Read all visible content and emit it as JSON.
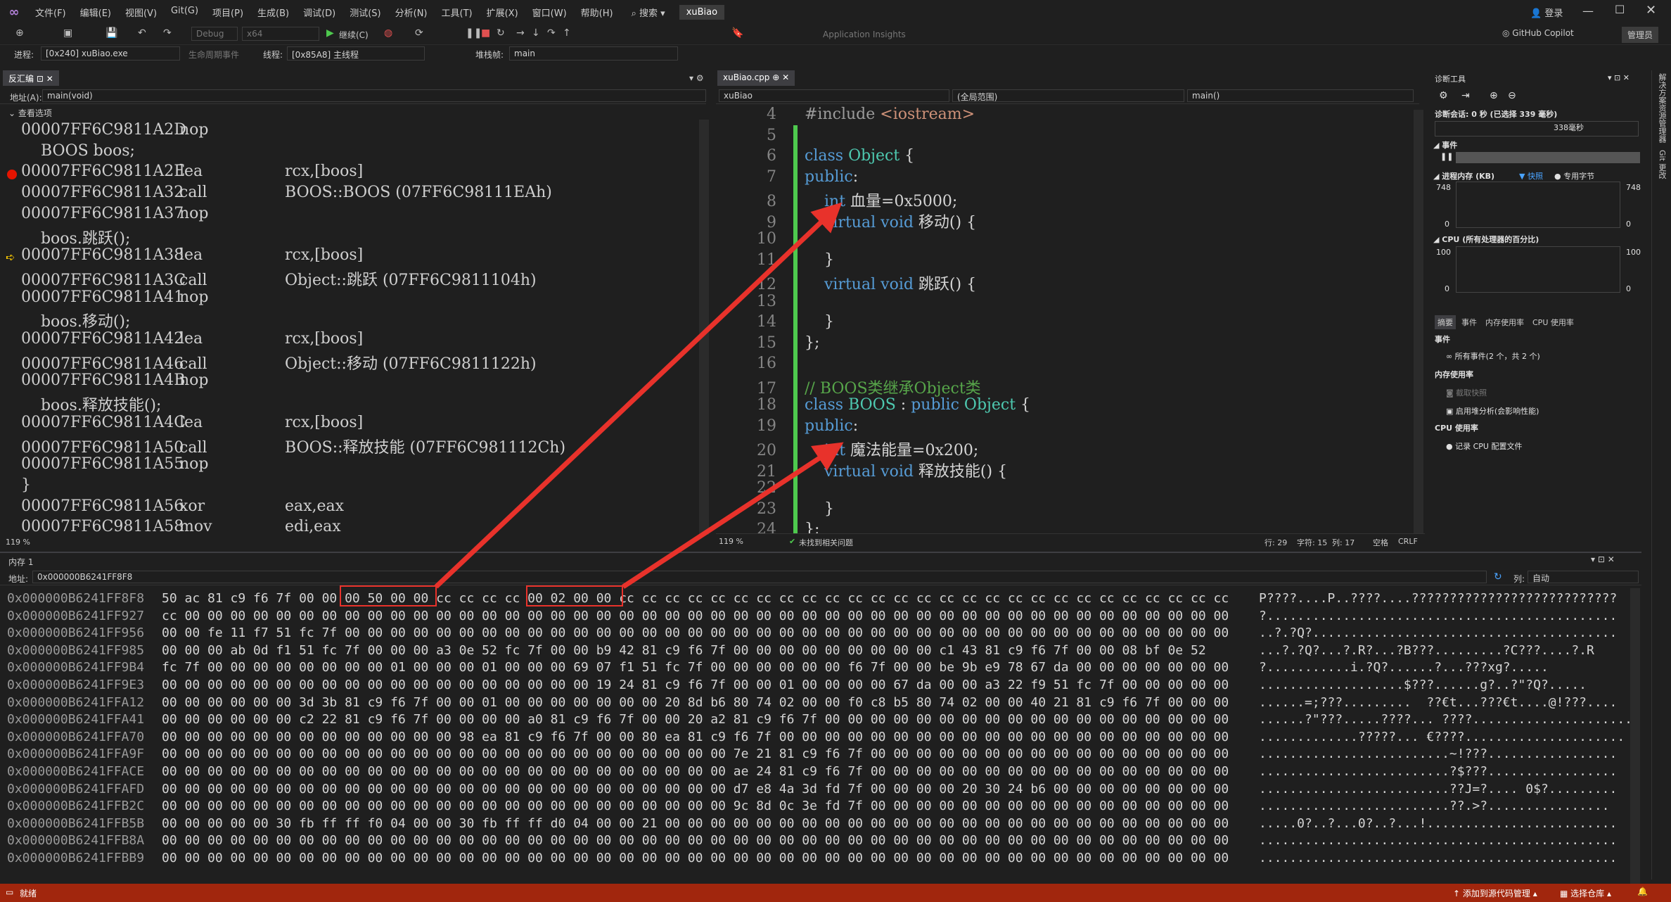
{
  "menu": {
    "logo": "vs-logo-icon",
    "items": [
      "文件(F)",
      "编辑(E)",
      "视图(V)",
      "Git(G)",
      "项目(P)",
      "生成(B)",
      "调试(D)",
      "测试(S)",
      "分析(N)",
      "工具(T)",
      "扩展(X)",
      "窗口(W)",
      "帮助(H)"
    ],
    "search": "搜索",
    "solution": "xuBiao",
    "login": "登录",
    "copilot": "GitHub Copilot",
    "admin": "管理员"
  },
  "toolbar": {
    "config": "Debug",
    "platform": "x64",
    "continue": "继续(C)",
    "app_insights": "Application Insights",
    "process_label": "进程:",
    "process_value": "[0x240] xuBiao.exe",
    "lifecycle": "生命周期事件",
    "thread_label": "线程:",
    "thread_value": "[0x85A8] 主线程",
    "stack_label": "堆栈帧:",
    "stack_value": "main"
  },
  "disasm": {
    "tab": "反汇编",
    "address_label": "地址(A):",
    "address_value": "main(void)",
    "options": "查看选项",
    "zoom": "119 %",
    "lines": [
      {
        "addr": "00007FF6C9811A2D",
        "mn": "nop",
        "op": ""
      },
      {
        "src": "    BOOS boos;"
      },
      {
        "addr": "00007FF6C9811A2E",
        "mn": "lea",
        "op": "rcx,[boos]",
        "bp": true
      },
      {
        "addr": "00007FF6C9811A32",
        "mn": "call",
        "op": "BOOS::BOOS (07FF6C98111EAh)"
      },
      {
        "addr": "00007FF6C9811A37",
        "mn": "nop",
        "op": ""
      },
      {
        "src": "    boos.跳跃();"
      },
      {
        "addr": "00007FF6C9811A38",
        "mn": "lea",
        "op": "rcx,[boos]",
        "cur": true
      },
      {
        "addr": "00007FF6C9811A3C",
        "mn": "call",
        "op": "Object::跳跃 (07FF6C9811104h)"
      },
      {
        "addr": "00007FF6C9811A41",
        "mn": "nop",
        "op": ""
      },
      {
        "src": "    boos.移动();"
      },
      {
        "addr": "00007FF6C9811A42",
        "mn": "lea",
        "op": "rcx,[boos]"
      },
      {
        "addr": "00007FF6C9811A46",
        "mn": "call",
        "op": "Object::移动 (07FF6C9811122h)"
      },
      {
        "addr": "00007FF6C9811A4B",
        "mn": "nop",
        "op": ""
      },
      {
        "src": "    boos.释放技能();"
      },
      {
        "addr": "00007FF6C9811A4C",
        "mn": "lea",
        "op": "rcx,[boos]"
      },
      {
        "addr": "00007FF6C9811A50",
        "mn": "call",
        "op": "BOOS::释放技能 (07FF6C981112Ch)"
      },
      {
        "addr": "00007FF6C9811A55",
        "mn": "nop",
        "op": ""
      },
      {
        "src": "}"
      },
      {
        "addr": "00007FF6C9811A56",
        "mn": "xor",
        "op": "eax,eax"
      },
      {
        "addr": "00007FF6C9811A58",
        "mn": "mov",
        "op": "edi,eax"
      }
    ]
  },
  "editor": {
    "tab": "xuBiao.cpp",
    "project": "xuBiao",
    "scope": "(全局范围)",
    "func": "main()",
    "zoom": "119 %",
    "issues": "未找到相关问题",
    "row": "行: 29",
    "col": "字符: 15",
    "colnum": "列: 17",
    "spaces": "空格",
    "eol": "CRLF",
    "lines": [
      {
        "n": "4",
        "t": "#include <iostream>"
      },
      {
        "n": "5",
        "t": ""
      },
      {
        "n": "6",
        "t": "class Object {"
      },
      {
        "n": "7",
        "t": "public:"
      },
      {
        "n": "8",
        "t": "    int 血量=0x5000;"
      },
      {
        "n": "9",
        "t": "    virtual void 移动() {"
      },
      {
        "n": "10",
        "t": ""
      },
      {
        "n": "11",
        "t": "    }"
      },
      {
        "n": "12",
        "t": "    virtual void 跳跃() {"
      },
      {
        "n": "13",
        "t": ""
      },
      {
        "n": "14",
        "t": "    }"
      },
      {
        "n": "15",
        "t": "};"
      },
      {
        "n": "16",
        "t": ""
      },
      {
        "n": "17",
        "t": "// BOOS类继承Object类"
      },
      {
        "n": "18",
        "t": "class BOOS : public Object {"
      },
      {
        "n": "19",
        "t": "public:"
      },
      {
        "n": "20",
        "t": "    int 魔法能量=0x200;"
      },
      {
        "n": "21",
        "t": "    virtual void 释放技能() {"
      },
      {
        "n": "22",
        "t": ""
      },
      {
        "n": "23",
        "t": "    }"
      },
      {
        "n": "24",
        "t": "};"
      }
    ]
  },
  "diag": {
    "title": "诊断工具",
    "session": "诊断会话: 0 秒 (已选择 339 毫秒)",
    "ms": "338毫秒",
    "events": "事件",
    "mem_title": "进程内存 (KB)",
    "snapshot": "快照",
    "private_bytes": "专用字节",
    "mem_max": "748",
    "mem_min": "0",
    "cpu_title": "CPU (所有处理器的百分比)",
    "cpu_max": "100",
    "cpu_min": "0",
    "tabs": [
      "摘要",
      "事件",
      "内存使用率",
      "CPU 使用率"
    ],
    "sec_events": "事件",
    "all_events": "所有事件(2 个，共 2 个)",
    "sec_mem": "内存使用率",
    "take_snapshot": "截取快照",
    "heap_analysis": "启用堆分析(会影响性能)",
    "sec_cpu": "CPU 使用率",
    "record_cpu": "记录 CPU 配置文件"
  },
  "memory": {
    "tab": "内存 1",
    "address_label": "地址:",
    "address_value": "0x000000B6241FF8F8",
    "col_label": "列:",
    "col_value": "自动",
    "rows": [
      {
        "a": "0x000000B6241FF8F8",
        "h": "50 ac 81 c9 f6 7f 00 00 00 50 00 00 cc cc cc cc 00 02 00 00 cc cc cc cc cc cc cc cc cc cc cc cc cc cc cc cc cc cc cc cc cc cc cc cc cc cc cc",
        "s": "P????....P..????....???????????????????????????"
      },
      {
        "a": "0x000000B6241FF927",
        "h": "cc 00 00 00 00 00 00 00 00 00 00 00 00 00 00 00 00 00 00 00 00 00 00 00 00 00 00 00 00 00 00 00 00 00 00 00 00 00 00 00 00 00 00 00 00 00 00",
        "s": "?.............................................."
      },
      {
        "a": "0x000000B6241FF956",
        "h": "00 00 fe 11 f7 51 fc 7f 00 00 00 00 00 00 00 00 00 00 00 00 00 00 00 00 00 00 00 00 00 00 00 00 00 00 00 00 00 00 00 00 00 00 00 00 00 00 00",
        "s": "..?.?Q?........................................"
      },
      {
        "a": "0x000000B6241FF985",
        "h": "00 00 00 ab 0d f1 51 fc 7f 00 00 00 a3 0e 52 fc 7f 00 00 b9 42 81 c9 f6 7f 00 00 00 00 00 00 00 00 00 c1 43 81 c9 f6 7f 00 00 08 bf 0e 52",
        "s": "...?.?Q?...?.R?...?B???.........?C???....?.R"
      },
      {
        "a": "0x000000B6241FF9B4",
        "h": "fc 7f 00 00 00 00 00 00 00 00 01 00 00 00 01 00 00 00 69 07 f1 51 fc 7f 00 00 00 00 00 00 f6 7f 00 00 be 9b e9 78 67 da 00 00 00 00 00 00 00",
        "s": "?...........i.?Q?......?...???xg?....."
      },
      {
        "a": "0x000000B6241FF9E3",
        "h": "00 00 00 00 00 00 00 00 00 00 00 00 00 00 00 00 00 00 00 19 24 81 c9 f6 7f 00 00 01 00 00 00 00 67 da 00 00 a3 22 f9 51 fc 7f 00 00 00 00 00",
        "s": "...................$???......g?..?\"?Q?....."
      },
      {
        "a": "0x000000B6241FFA12",
        "h": "00 00 00 00 00 00 3d 3b 81 c9 f6 7f 00 00 01 00 00 00 00 00 00 00 20 8d b6 80 74 02 00 00 f0 c8 b5 80 74 02 00 00 40 21 81 c9 f6 7f 00 00 00",
        "s": "......=;???.........  ??€t...???€t....@!???...."
      },
      {
        "a": "0x000000B6241FFA41",
        "h": "00 00 00 00 00 00 c2 22 81 c9 f6 7f 00 00 00 00 a0 81 c9 f6 7f 00 00 20 a2 81 c9 f6 7f 00 00 00 00 00 00 00 00 00 00 00 00 00 00 00 00 00 00",
        "s": "......?\"???.....????... ????......................"
      },
      {
        "a": "0x000000B6241FFA70",
        "h": "00 00 00 00 00 00 00 00 00 00 00 00 00 98 ea 81 c9 f6 7f 00 00 80 ea 81 c9 f6 7f 00 00 00 00 00 00 00 00 00 00 00 00 00 00 00 00 00 00 00 00",
        "s": ".............?????... €????....................."
      },
      {
        "a": "0x000000B6241FFA9F",
        "h": "00 00 00 00 00 00 00 00 00 00 00 00 00 00 00 00 00 00 00 00 00 00 00 00 00 7e 21 81 c9 f6 7f 00 00 00 00 00 00 00 00 00 00 00 00 00 00 00 00",
        "s": ".........................~!???................."
      },
      {
        "a": "0x000000B6241FFACE",
        "h": "00 00 00 00 00 00 00 00 00 00 00 00 00 00 00 00 00 00 00 00 00 00 00 00 00 ae 24 81 c9 f6 7f 00 00 00 00 00 00 00 00 00 00 00 00 00 00 00 00",
        "s": ".........................?$???................."
      },
      {
        "a": "0x000000B6241FFAFD",
        "h": "00 00 00 00 00 00 00 00 00 00 00 00 00 00 00 00 00 00 00 00 00 00 00 00 00 d7 e8 4a 3d fd 7f 00 00 00 00 20 30 24 b6 00 00 00 00 00 00 00 00",
        "s": ".........................??J=?.... 0$?........."
      },
      {
        "a": "0x000000B6241FFB2C",
        "h": "00 00 00 00 00 00 00 00 00 00 00 00 00 00 00 00 00 00 00 00 00 00 00 00 00 9c 8d 0c 3e fd 7f 00 00 00 00 00 00 00 00 00 00 00 00 00 00 00 00",
        "s": ".........................??.>?................"
      },
      {
        "a": "0x000000B6241FFB5B",
        "h": "00 00 00 00 00 30 fb ff ff f0 04 00 00 30 fb ff ff d0 04 00 00 21 00 00 00 00 00 00 00 00 00 00 00 00 00 00 00 00 00 00 00 00 00 00 00 00 00",
        "s": ".....0?..?...0?..?...!........................."
      },
      {
        "a": "0x000000B6241FFB8A",
        "h": "00 00 00 00 00 00 00 00 00 00 00 00 00 00 00 00 00 00 00 00 00 00 00 00 00 00 00 00 00 00 00 00 00 00 00 00 00 00 00 00 00 00 00 00 00 00 00",
        "s": "..............................................."
      },
      {
        "a": "0x000000B6241FFBB9",
        "h": "00 00 00 00 00 00 00 00 00 00 00 00 00 00 00 00 00 00 00 00 00 00 00 00 00 00 00 00 00 00 00 00 00 00 00 00 00 00 00 00 00 00 00 00 00 00 00",
        "s": "..............................................."
      }
    ]
  },
  "status": {
    "ready": "就绪",
    "add_source": "添加到源代码管理",
    "select_repo": "选择仓库"
  },
  "side": {
    "solution_explorer": "解决方案资源管理器",
    "git_changes": "Git 更改"
  },
  "colors": {
    "accent": "#68217a",
    "status_bg": "#a1260d",
    "annotation": "#e8322b",
    "keyword": "#569cd6",
    "type": "#4ec9b0",
    "comment": "#57a64a"
  }
}
